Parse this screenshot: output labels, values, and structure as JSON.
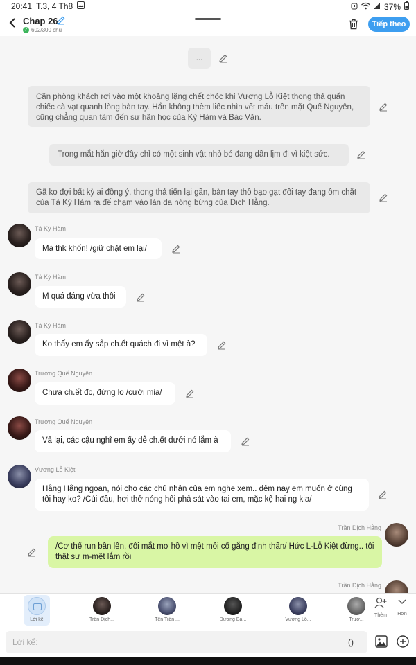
{
  "status": {
    "time": "20:41",
    "date": "T.3, 4 Th8",
    "battery": "37%"
  },
  "header": {
    "title": "Chap 26",
    "word_count": "602/300 chữ",
    "next_label": "Tiếp theo"
  },
  "messages": [
    {
      "type": "narration",
      "text": "..."
    },
    {
      "type": "narration",
      "text": "Căn phòng khách rơi vào một khoảng lặng chết chóc khi Vương Lỗ Kiệt thong thả quấn chiếc cà vạt quanh lòng bàn tay. Hắn không thèm liếc nhìn vết máu trên mặt Quế Nguyên, cũng chẳng quan tâm đến sự hãn học của Kỳ Hàm và Bác Văn."
    },
    {
      "type": "narration",
      "text": "Trong mắt hắn giờ đây chỉ có một sinh vật nhỏ bé đang dần lịm đi vì kiệt sức."
    },
    {
      "type": "narration",
      "text": "Gã ko đợi bất kỳ ai đồng ý, thong thả tiến lại gần, bàn tay thô bạo gạt đôi tay đang ôm chặt của Tả Kỳ Hàm ra để chạm vào làn da nóng bừng của Dịch Hằng."
    },
    {
      "type": "chat",
      "sender": "Tả Kỳ Hàm",
      "text": "Má thk khốn! /giữ chặt em lại/"
    },
    {
      "type": "chat",
      "sender": "Tả Kỳ Hàm",
      "text": "M quá đáng vừa thôi"
    },
    {
      "type": "chat",
      "sender": "Tả Kỳ Hàm",
      "text": "Ko thấy em ấy sắp ch.ết quách đi vì mệt à?"
    },
    {
      "type": "chat",
      "sender": "Trương Quế Nguyên",
      "text": "Chưa ch.ết đc, đừng lo /cười mỉa/"
    },
    {
      "type": "chat",
      "sender": "Trương Quế Nguyên",
      "text": "Vả lại, các cậu nghĩ em ấy dễ ch.ết dưới nó lắm à"
    },
    {
      "type": "chat",
      "sender": "Vương Lỗ Kiệt",
      "text": "Hằng Hằng ngoan, nói cho các chủ nhân của em nghe xem.. đêm nay em muốn ở cùng tôi hay ko? /Cúi đầu, hơi thở nóng hổi phả sát vào tai em, mặc kệ hai ng kia/"
    },
    {
      "type": "chat_me",
      "sender": "Trần Dịch Hằng",
      "text": "/Cơ thể run bần lên, đôi mắt mơ hồ vì mệt mỏi cố gắng định thần/ Hức L-Lỗ Kiệt đừng.. tôi thật sự m-mệt lắm rồi"
    },
    {
      "type": "chat_me",
      "sender": "Trần Dịch Hằng",
      "text": ""
    }
  ],
  "character_bar": {
    "selected_label": "Lời kể",
    "characters": [
      "Trần Dịch...",
      "Tên Trần ...",
      "Dương Bá...",
      "Vương Lỗ...",
      "Trươ..."
    ],
    "follow_label": "Thêm",
    "more_label": "Hơn"
  },
  "input": {
    "placeholder": "Lời kể:",
    "paren": "()"
  },
  "colors": {
    "accent": "#3d9ef0",
    "my_bubble": "#d9f6a5",
    "narration_bg": "#e9e9e9"
  }
}
